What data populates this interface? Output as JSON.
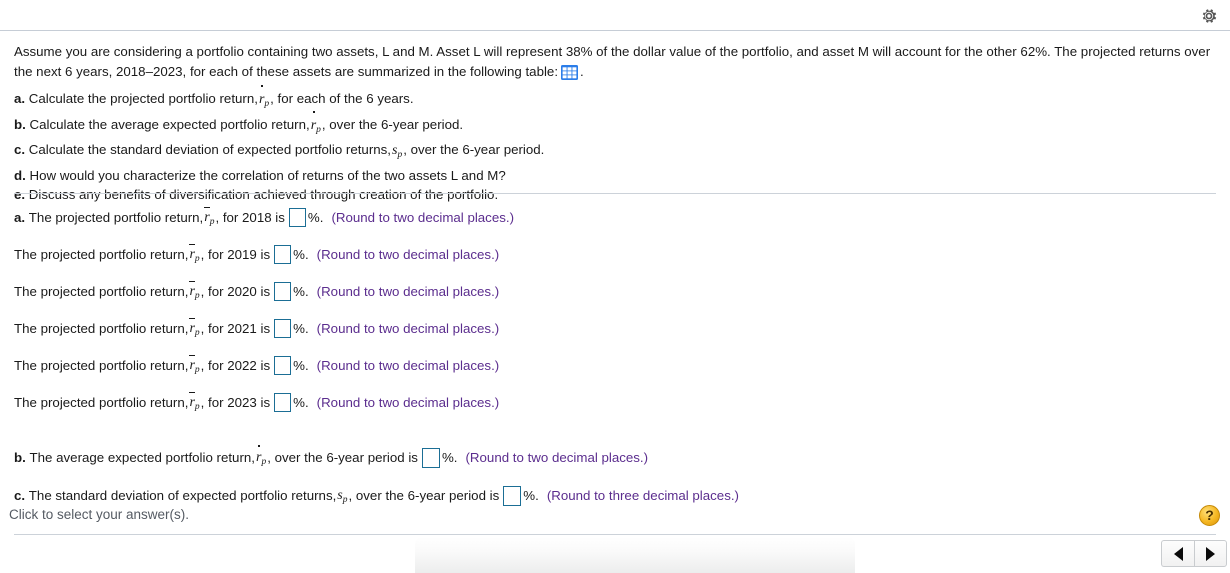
{
  "header": {
    "gear_icon": "gear-icon"
  },
  "stem": {
    "paragraph_1": "Assume you are considering a portfolio containing two assets, L and M. Asset L will represent 38% of the dollar value of the portfolio, and asset M will account for the other 62%. The projected returns over the next 6 years, 2018–2023, for each of these assets are summarized in the following table:",
    "table_icon": "table-icon",
    "paragraph_1_end": ".",
    "parts": [
      {
        "label": "a.",
        "text": "Calculate the projected portfolio return,",
        "var": "rp_bar",
        "text_after": ", for each of the 6 years."
      },
      {
        "label": "b.",
        "text": "Calculate the average expected portfolio return,",
        "var": "rp_bar",
        "text_after": ", over the 6-year period."
      },
      {
        "label": "c.",
        "text": "Calculate the standard deviation of expected portfolio returns,",
        "var": "sp",
        "text_after": ", over the 6-year period."
      },
      {
        "label": "d.",
        "text": "How would you characterize the correlation of returns of the two assets L and M?",
        "var": "",
        "text_after": ""
      },
      {
        "label": "e.",
        "text": "Discuss any benefits of diversification achieved through creation of the portfolio.",
        "var": "",
        "text_after": ""
      }
    ]
  },
  "answers": {
    "rows": [
      {
        "label": "a.",
        "prefix": "The projected portfolio return,",
        "var": "rp_bar",
        "middle": ", for 2018 is",
        "value": "",
        "unit": "%.",
        "hint": "(Round to two decimal places.)"
      },
      {
        "label": "",
        "prefix": "The projected portfolio return,",
        "var": "rp_bar",
        "middle": ", for 2019 is",
        "value": "",
        "unit": "%.",
        "hint": "(Round to two decimal places.)"
      },
      {
        "label": "",
        "prefix": "The projected portfolio return,",
        "var": "rp_bar",
        "middle": ", for 2020 is",
        "value": "",
        "unit": "%.",
        "hint": "(Round to two decimal places.)"
      },
      {
        "label": "",
        "prefix": "The projected portfolio return,",
        "var": "rp_bar",
        "middle": ", for 2021 is",
        "value": "",
        "unit": "%.",
        "hint": "(Round to two decimal places.)"
      },
      {
        "label": "",
        "prefix": "The projected portfolio return,",
        "var": "rp_bar",
        "middle": " , for 2022 is",
        "value": "",
        "unit": "%.",
        "hint": "(Round to two decimal places.)"
      },
      {
        "label": "",
        "prefix": "The projected portfolio return,",
        "var": "rp_bar",
        "middle": ", for 2023 is",
        "value": "",
        "unit": "%.",
        "hint": "(Round to two decimal places.)"
      }
    ],
    "row_b": {
      "label": "b.",
      "prefix": "The average expected portfolio return,",
      "var": "rp_bar",
      "middle": ", over the 6-year period is",
      "value": "",
      "unit": "%.",
      "hint": "(Round to two decimal places.)"
    },
    "row_c": {
      "label": "c.",
      "prefix": "The standard deviation of expected portfolio returns,",
      "var": "sp",
      "middle": ", over the 6-year period is",
      "value": "",
      "unit": "%.",
      "hint": "(Round to three decimal places.)"
    }
  },
  "footer": {
    "hint": "Click to select your answer(s).",
    "help_label": "?",
    "prev_icon": "triangle-left-icon",
    "next_icon": "triangle-right-icon"
  },
  "colors": {
    "hint_purple": "#5b2d8e",
    "input_border": "#1b6e95",
    "table_icon_blue": "#2b7de9",
    "help_yellow": "#f5b722",
    "divider": "#ccd2d9",
    "text": "#1a1a1a"
  }
}
